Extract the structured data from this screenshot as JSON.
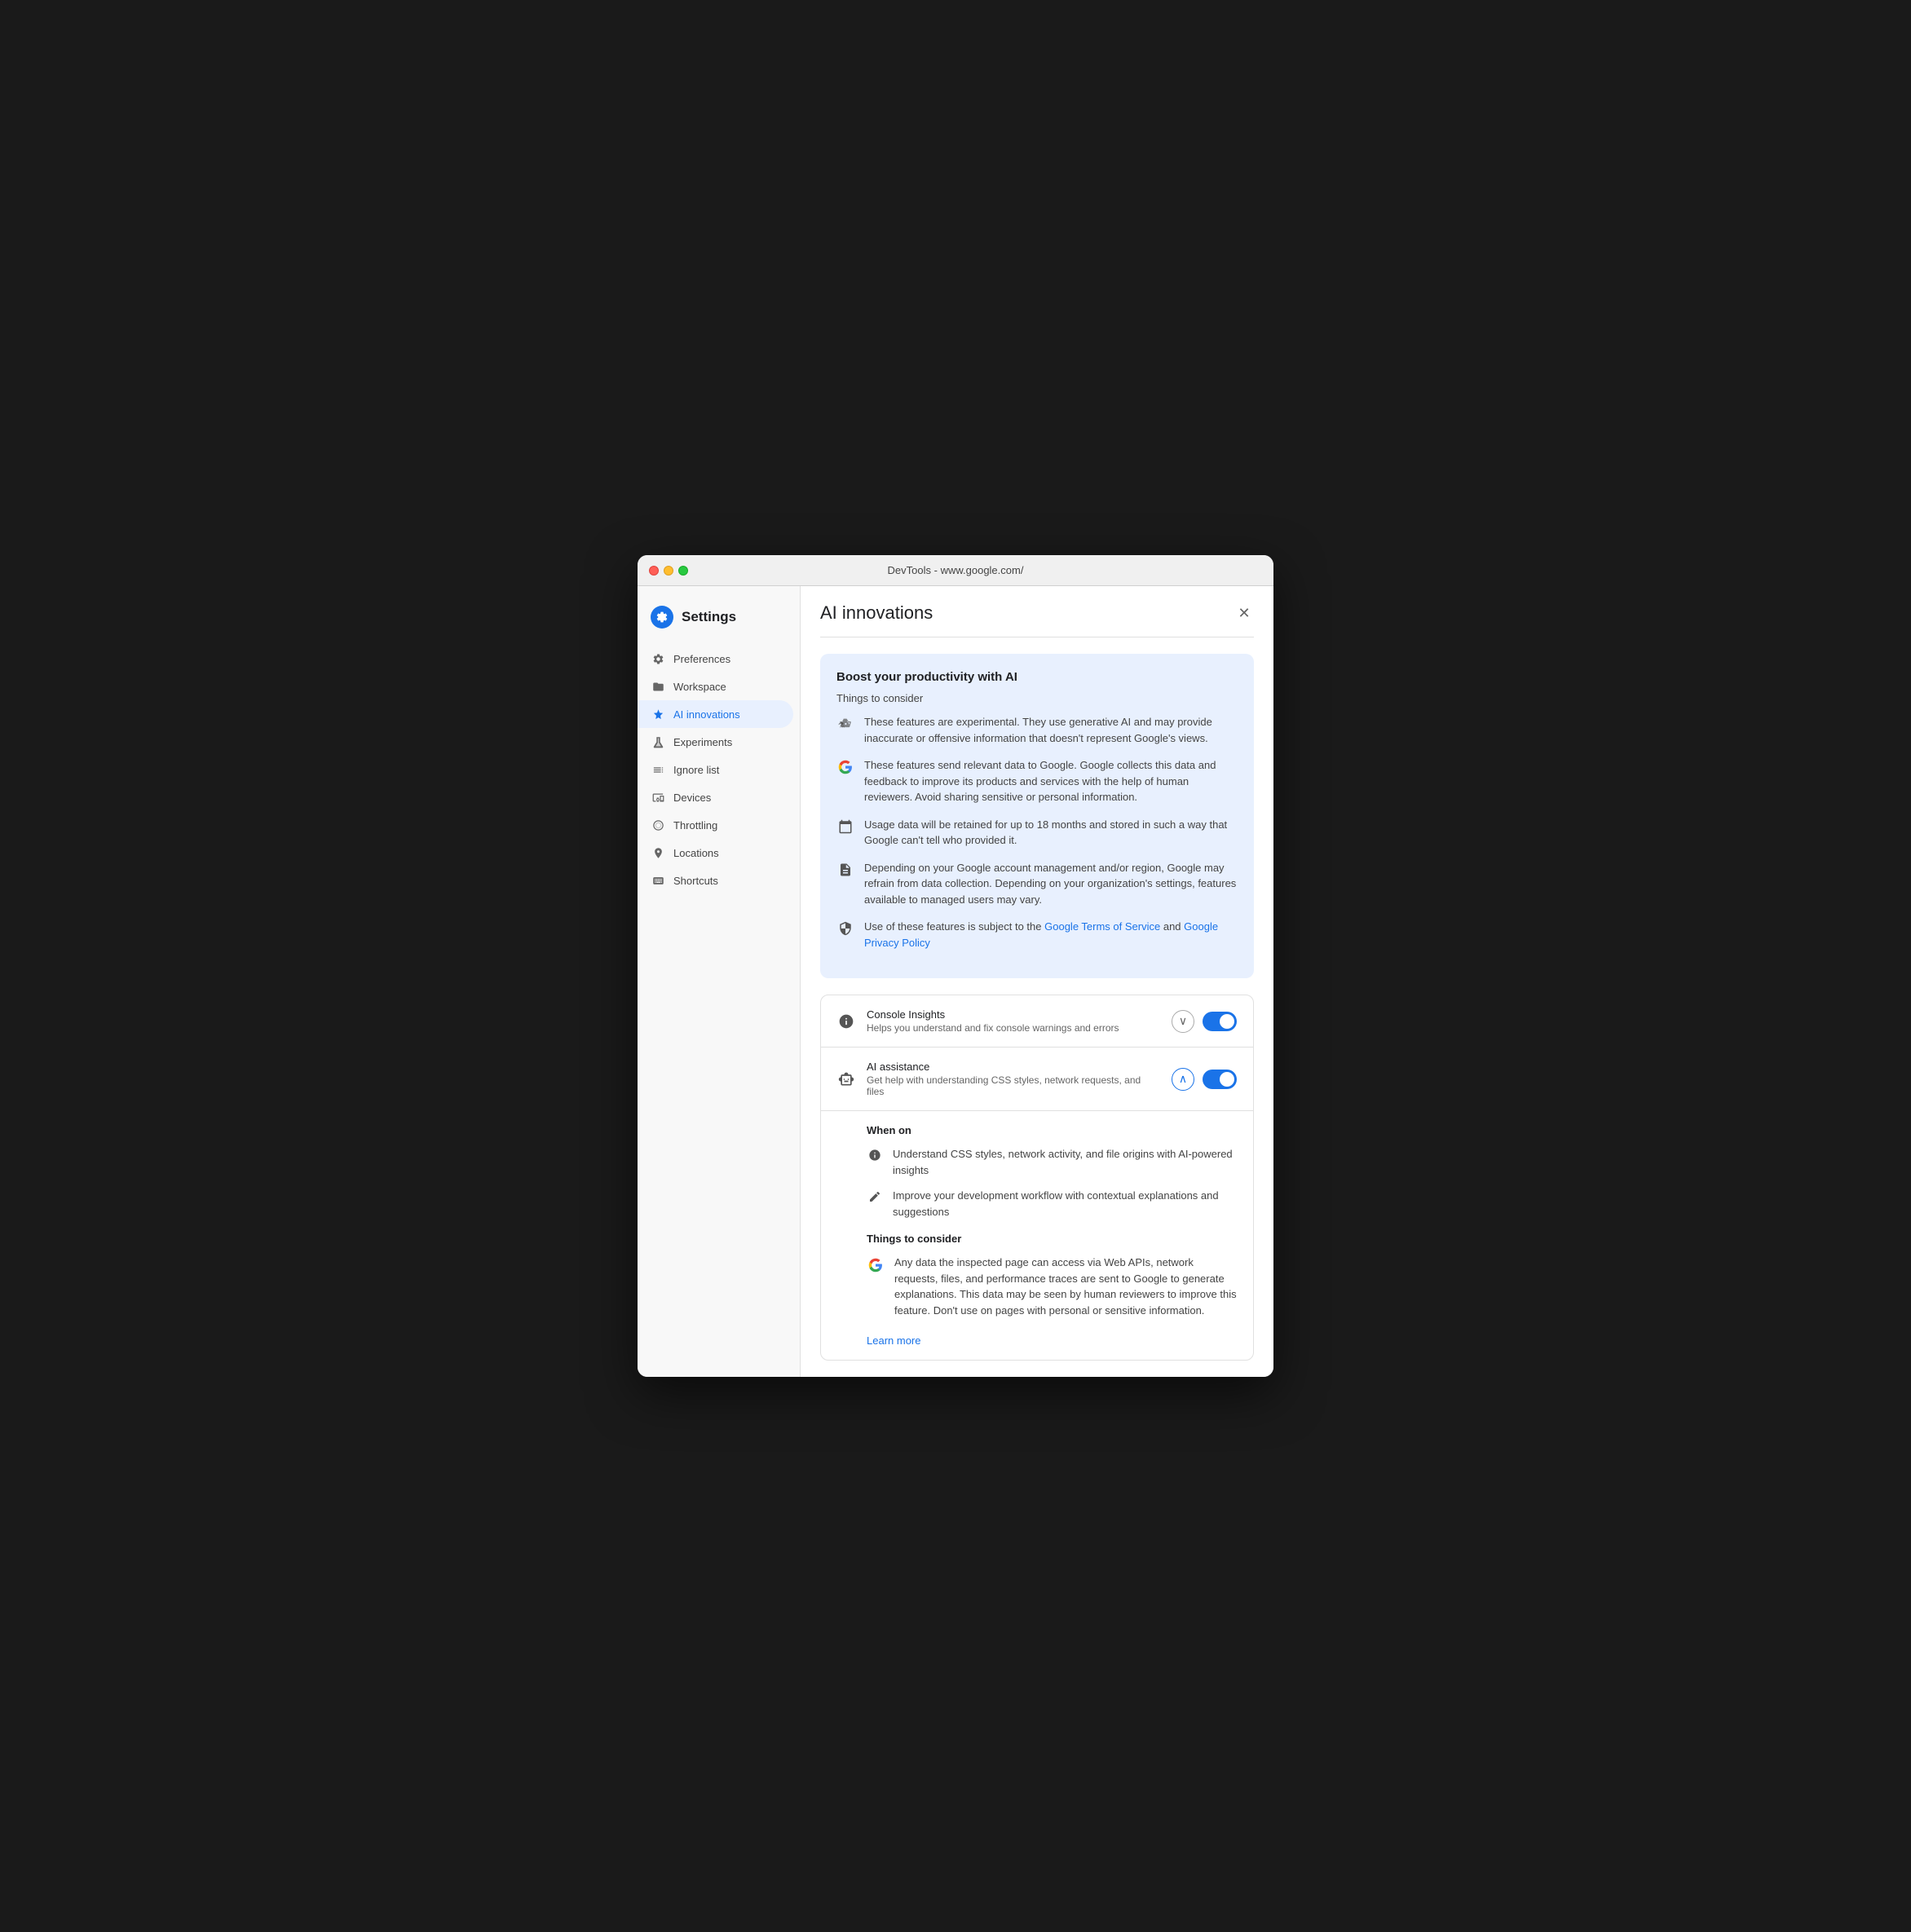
{
  "window": {
    "titlebar_text": "DevTools - www.google.com/"
  },
  "sidebar": {
    "settings_label": "Settings",
    "items": [
      {
        "id": "preferences",
        "label": "Preferences",
        "icon": "⚙"
      },
      {
        "id": "workspace",
        "label": "Workspace",
        "icon": "📁"
      },
      {
        "id": "ai-innovations",
        "label": "AI innovations",
        "icon": "✦",
        "active": true
      },
      {
        "id": "experiments",
        "label": "Experiments",
        "icon": "🧪"
      },
      {
        "id": "ignore-list",
        "label": "Ignore list",
        "icon": "≡"
      },
      {
        "id": "devices",
        "label": "Devices",
        "icon": "⬜"
      },
      {
        "id": "throttling",
        "label": "Throttling",
        "icon": "⊘"
      },
      {
        "id": "locations",
        "label": "Locations",
        "icon": "📍"
      },
      {
        "id": "shortcuts",
        "label": "Shortcuts",
        "icon": "⌨"
      }
    ]
  },
  "main": {
    "title": "AI innovations",
    "info_box": {
      "title": "Boost your productivity with AI",
      "subtitle": "Things to consider",
      "items": [
        {
          "id": "experimental",
          "icon": "experimental",
          "text": "These features are experimental. They use generative AI and may provide inaccurate or offensive information that doesn't represent Google's views."
        },
        {
          "id": "data-send",
          "icon": "google",
          "text": "These features send relevant data to Google. Google collects this data and feedback to improve its products and services with the help of human reviewers. Avoid sharing sensitive or personal information."
        },
        {
          "id": "retention",
          "icon": "calendar",
          "text": "Usage data will be retained for up to 18 months and stored in such a way that Google can't tell who provided it."
        },
        {
          "id": "account",
          "icon": "document",
          "text": "Depending on your Google account management and/or region, Google may refrain from data collection. Depending on your organization's settings, features available to managed users may vary."
        },
        {
          "id": "terms",
          "icon": "shield",
          "text_before": "Use of these features is subject to the ",
          "link1_text": "Google Terms of Service",
          "link1_url": "#",
          "text_between": " and ",
          "link2_text": "Google Privacy Policy",
          "link2_url": "#"
        }
      ]
    },
    "features": [
      {
        "id": "console-insights",
        "icon": "💡",
        "title": "Console Insights",
        "description": "Helps you understand and fix console warnings and errors",
        "has_chevron": true,
        "chevron_direction": "down",
        "toggle_on": true
      },
      {
        "id": "ai-assistance",
        "icon": "ai",
        "title": "AI assistance",
        "description": "Get help with understanding CSS styles, network requests, and files",
        "has_chevron": true,
        "chevron_direction": "up",
        "toggle_on": true,
        "expanded": true
      }
    ],
    "when_on_label": "When on",
    "when_on_items": [
      {
        "icon": "info",
        "text": "Understand CSS styles, network activity, and file origins with AI-powered insights"
      },
      {
        "icon": "pencil",
        "text": "Improve your development workflow with contextual explanations and suggestions"
      }
    ],
    "things_to_consider_label": "Things to consider",
    "things_to_consider_items": [
      {
        "icon": "google",
        "text": "Any data the inspected page can access via Web APIs, network requests, files, and performance traces are sent to Google to generate explanations. This data may be seen by human reviewers to improve this feature. Don't use on pages with personal or sensitive information."
      }
    ],
    "learn_more_label": "Learn more",
    "learn_more_url": "#"
  }
}
